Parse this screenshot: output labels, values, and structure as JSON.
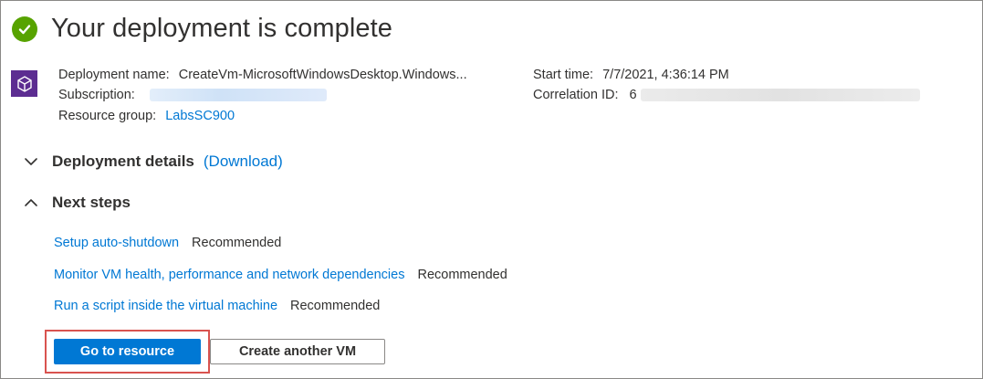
{
  "header": {
    "title": "Your deployment is complete",
    "status_icon": "success-check-icon",
    "status_color": "#57a300"
  },
  "resource_icon": {
    "name": "vm-deployment-icon",
    "color": "#5c2d91"
  },
  "details": {
    "deployment_name_label": "Deployment name:",
    "deployment_name_value": "CreateVm-MicrosoftWindowsDesktop.Windows...",
    "subscription_label": "Subscription:",
    "resource_group_label": "Resource group:",
    "resource_group_value": "LabsSC900",
    "start_time_label": "Start time:",
    "start_time_value": "7/7/2021, 4:36:14 PM",
    "correlation_id_label": "Correlation ID:",
    "correlation_id_prefix": "6"
  },
  "deployment_details": {
    "title": "Deployment details",
    "download_link": "(Download)",
    "expanded": false
  },
  "next_steps": {
    "title": "Next steps",
    "expanded": true,
    "items": [
      {
        "link": "Setup auto-shutdown",
        "tag": "Recommended"
      },
      {
        "link": "Monitor VM health, performance and network dependencies",
        "tag": "Recommended"
      },
      {
        "link": "Run a script inside the virtual machine",
        "tag": "Recommended"
      }
    ]
  },
  "actions": {
    "primary_label": "Go to resource",
    "secondary_label": "Create another VM",
    "accent_color": "#0078d4",
    "highlight_color": "#d9534f"
  }
}
